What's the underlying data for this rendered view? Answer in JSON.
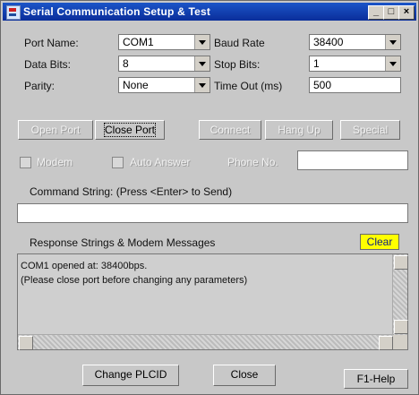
{
  "window": {
    "title": "Serial Communication Setup & Test"
  },
  "settings": {
    "port_name_label": "Port Name:",
    "port_name_value": "COM1",
    "baud_rate_label": "Baud Rate",
    "baud_rate_value": "38400",
    "data_bits_label": "Data Bits:",
    "data_bits_value": "8",
    "stop_bits_label": "Stop Bits:",
    "stop_bits_value": "1",
    "parity_label": "Parity:",
    "parity_value": "None",
    "timeout_label": "Time Out (ms)",
    "timeout_value": "500"
  },
  "buttons": {
    "open_port": "Open Port",
    "close_port": "Close Port",
    "connect": "Connect",
    "hang_up": "Hang Up",
    "special": "Special",
    "clear": "Clear",
    "change_plcid": "Change PLCID",
    "close": "Close",
    "help": "F1-Help"
  },
  "modem": {
    "modem_label": "Modem",
    "auto_answer_label": "Auto Answer",
    "phone_label": "Phone No."
  },
  "command": {
    "label": "Command String: (Press <Enter> to Send)",
    "value": ""
  },
  "response": {
    "label": "Response Strings & Modem Messages",
    "lines": "COM1 opened at: 38400bps.\n(Please close port before changing any parameters)"
  }
}
